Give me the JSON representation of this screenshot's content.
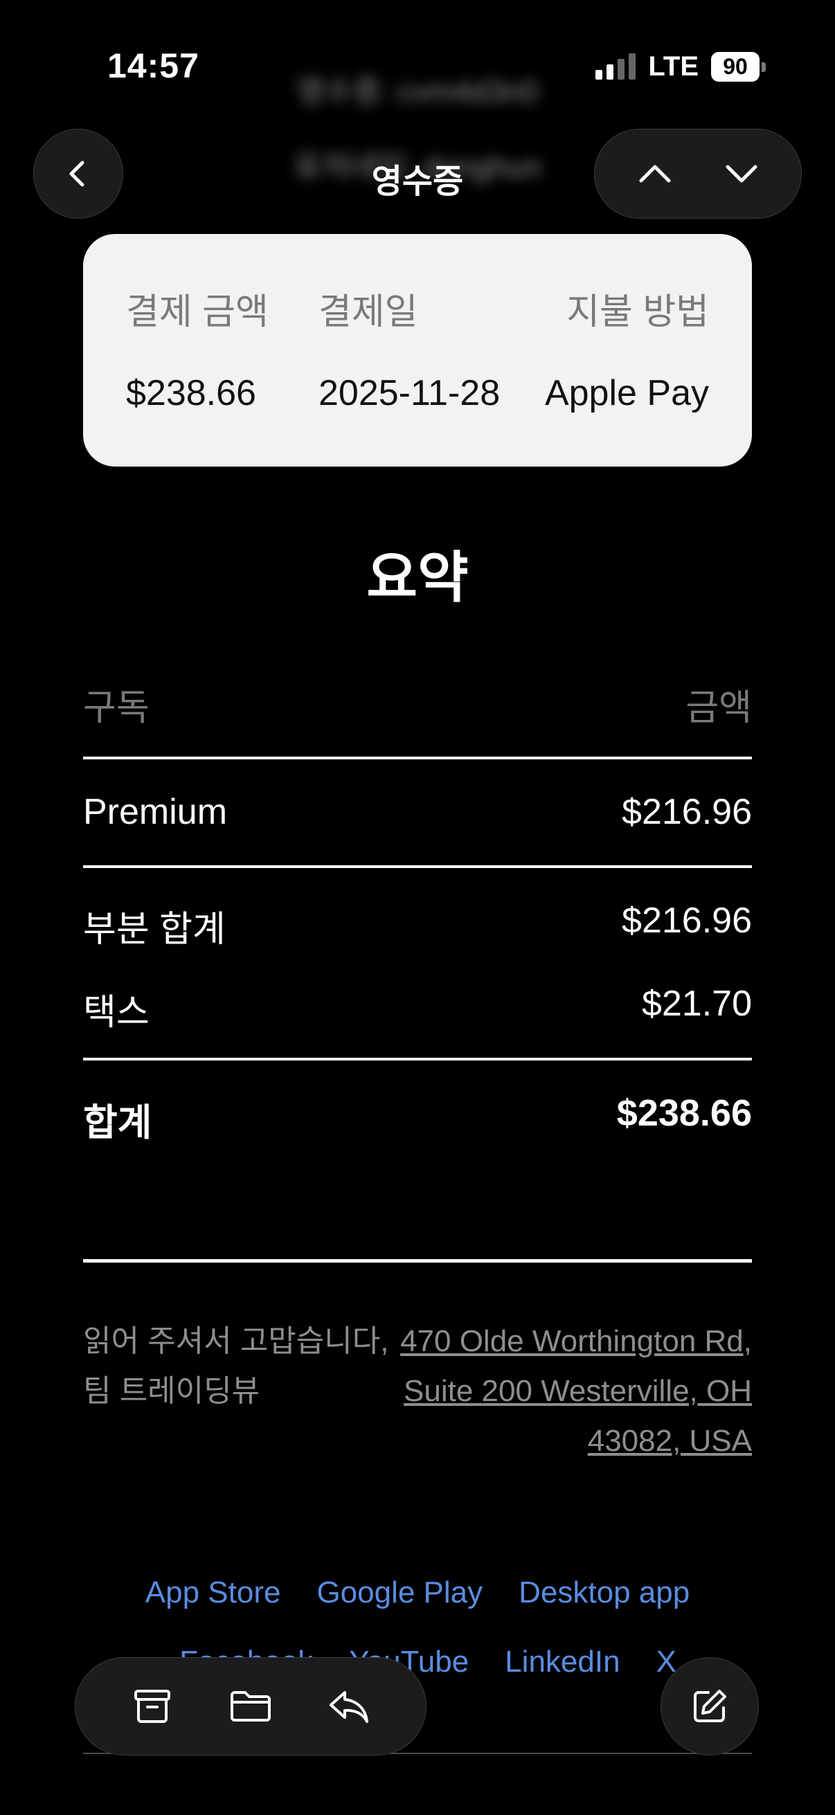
{
  "status": {
    "time": "14:57",
    "network": "LTE",
    "battery": "90"
  },
  "blurred": {
    "subject": "영수증: cvm4d3n0",
    "sender": "유저네임: donghun"
  },
  "nav": {
    "title": "영수증"
  },
  "payment": {
    "amount_label": "결제 금액",
    "date_label": "결제일",
    "method_label": "지불 방법",
    "amount": "$238.66",
    "date": "2025-11-28",
    "method": "Apple Pay"
  },
  "summary": {
    "title": "요약",
    "col_subscription": "구독",
    "col_amount": "금액",
    "items": [
      {
        "name": "Premium",
        "amount": "$216.96"
      }
    ],
    "subtotal_label": "부분 합계",
    "subtotal": "$216.96",
    "tax_label": "택스",
    "tax": "$21.70",
    "total_label": "합계",
    "total": "$238.66"
  },
  "footer": {
    "thanks_line1": "읽어 주셔서 고맙습니다,",
    "thanks_line2": "팀 트레이딩뷰",
    "address": "470 Olde Worthington Rd, Suite 200 Westerville, OH 43082, USA",
    "links_row1": [
      "App Store",
      "Google Play",
      "Desktop app"
    ],
    "links_row2": [
      "Facebook",
      "YouTube",
      "LinkedIn",
      "X"
    ]
  },
  "icons": [
    "chevron-left-icon",
    "chevron-up-icon",
    "chevron-down-icon",
    "archive-icon",
    "folder-icon",
    "reply-icon",
    "compose-icon"
  ],
  "colors": {
    "background": "#000000",
    "card": "#f2f2f2",
    "link": "#5b8ce0",
    "muted": "#8e8e8e"
  }
}
